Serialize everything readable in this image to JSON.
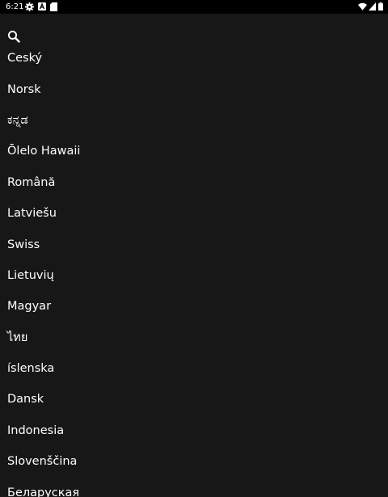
{
  "status_bar": {
    "time": "6:21",
    "left_icons": [
      "gear-icon",
      "a-badge-icon",
      "sd-card-icon"
    ],
    "right_icons": [
      "wifi-icon",
      "signal-icon",
      "battery-icon"
    ]
  },
  "search": {
    "icon": "search-icon"
  },
  "languages": [
    "Ceský",
    "Norsk",
    "ಕನ್ನಡ",
    "Ōlelo Hawaii",
    "Română",
    "Latviešu",
    "Swiss",
    "Lietuvių",
    "Magyar",
    "ไทย",
    "íslenska",
    "Dansk",
    "Indonesia",
    "Slovenščina",
    "Беларуская"
  ],
  "colors": {
    "status_bar_bg": "#000000",
    "surface_bg": "#171717",
    "text": "#ffffff"
  }
}
